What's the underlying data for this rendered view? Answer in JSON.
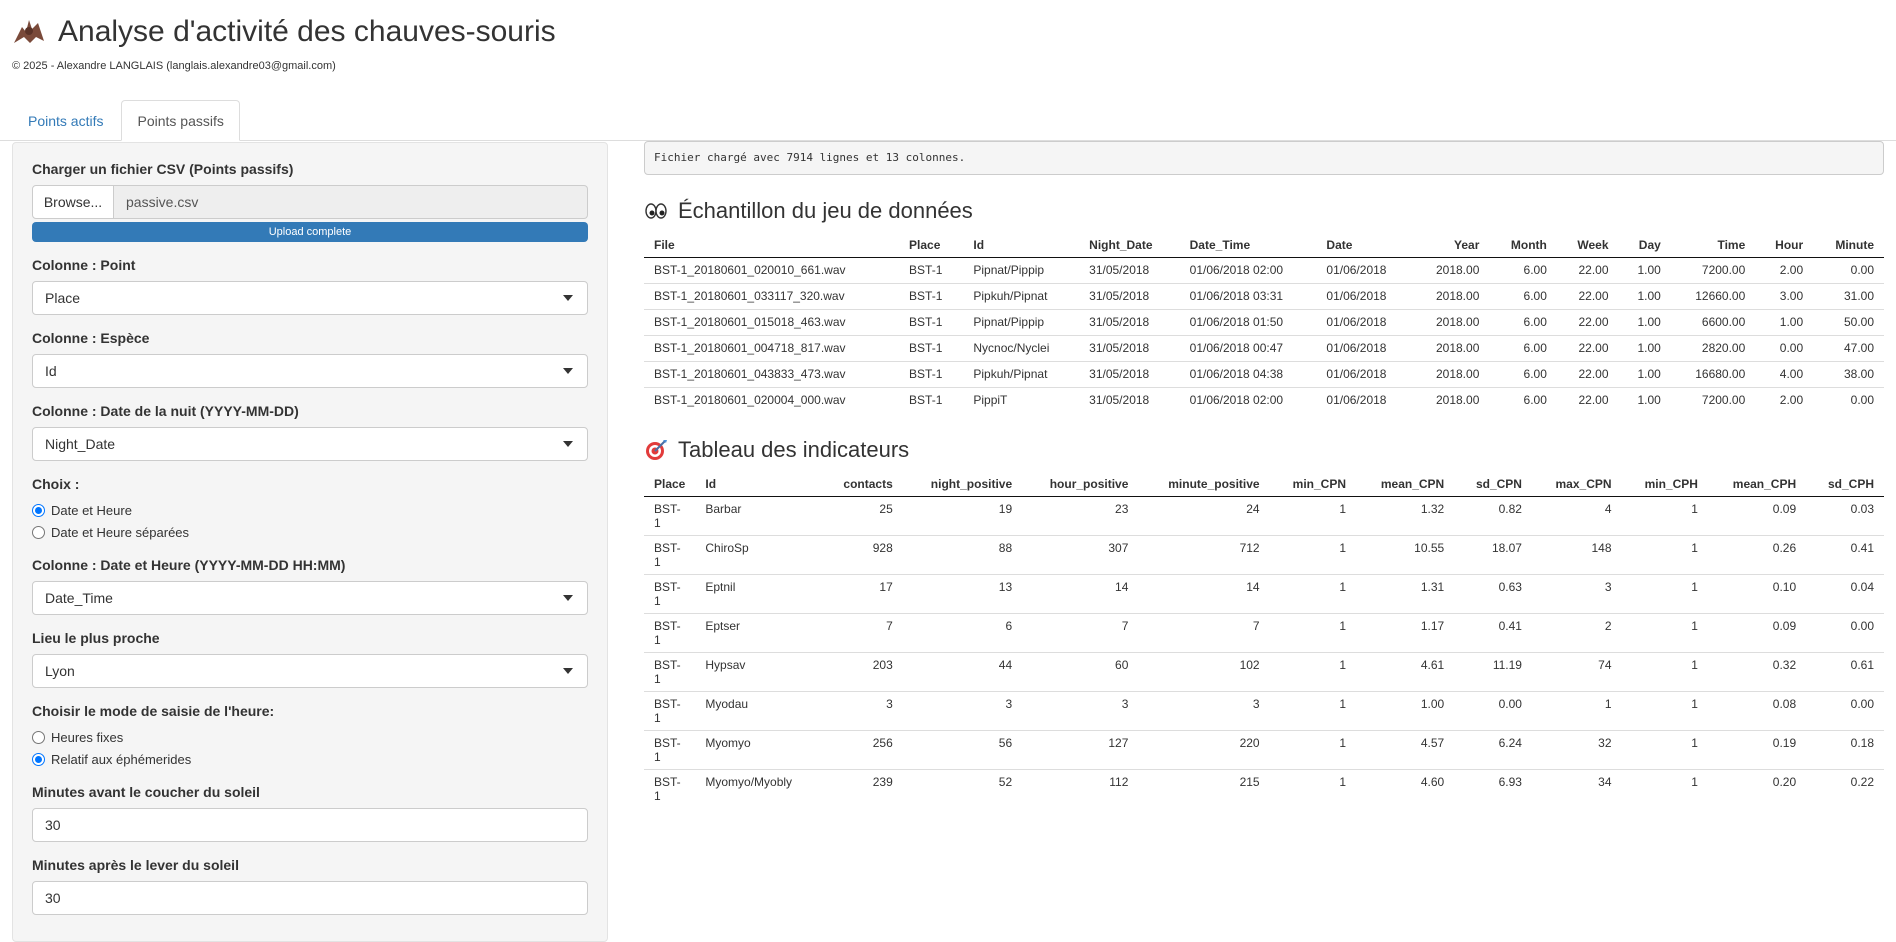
{
  "header": {
    "title": "Analyse d'activité des chauves-souris",
    "copyright": "© 2025 - Alexandre LANGLAIS (langlais.alexandre03@gmail.com)"
  },
  "tabs": [
    {
      "label": "Points actifs",
      "active": false
    },
    {
      "label": "Points passifs",
      "active": true
    }
  ],
  "sidebar": {
    "file_label": "Charger un fichier CSV (Points passifs)",
    "browse_label": "Browse...",
    "file_name": "passive.csv",
    "upload_status": "Upload complete",
    "point_label": "Colonne : Point",
    "point_value": "Place",
    "species_label": "Colonne : Espèce",
    "species_value": "Id",
    "night_label": "Colonne : Date de la nuit (YYYY-MM-DD)",
    "night_value": "Night_Date",
    "choice_label": "Choix :",
    "choice_options": [
      "Date et Heure",
      "Date et Heure séparées"
    ],
    "datetime_label": "Colonne : Date et Heure (YYYY-MM-DD HH:MM)",
    "datetime_value": "Date_Time",
    "place_label": "Lieu le plus proche",
    "place_value": "Lyon",
    "mode_label": "Choisir le mode de saisie de l'heure:",
    "mode_options": [
      "Heures fixes",
      "Relatif aux éphémerides"
    ],
    "before_label": "Minutes avant le coucher du soleil",
    "before_value": "30",
    "after_label": "Minutes après le lever du soleil",
    "after_value": "30"
  },
  "main": {
    "status": "Fichier chargé avec 7914 lignes et 13 colonnes.",
    "sample_title": "Échantillon du jeu de données",
    "sample_headers": [
      "File",
      "Place",
      "Id",
      "Night_Date",
      "Date_Time",
      "Date",
      "Year",
      "Month",
      "Week",
      "Day",
      "Time",
      "Hour",
      "Minute"
    ],
    "sample_rows": [
      [
        "BST-1_20180601_020010_661.wav",
        "BST-1",
        "Pipnat/Pippip",
        "31/05/2018",
        "01/06/2018 02:00",
        "01/06/2018",
        "2018.00",
        "6.00",
        "22.00",
        "1.00",
        "7200.00",
        "2.00",
        "0.00"
      ],
      [
        "BST-1_20180601_033117_320.wav",
        "BST-1",
        "Pipkuh/Pipnat",
        "31/05/2018",
        "01/06/2018 03:31",
        "01/06/2018",
        "2018.00",
        "6.00",
        "22.00",
        "1.00",
        "12660.00",
        "3.00",
        "31.00"
      ],
      [
        "BST-1_20180601_015018_463.wav",
        "BST-1",
        "Pipnat/Pippip",
        "31/05/2018",
        "01/06/2018 01:50",
        "01/06/2018",
        "2018.00",
        "6.00",
        "22.00",
        "1.00",
        "6600.00",
        "1.00",
        "50.00"
      ],
      [
        "BST-1_20180601_004718_817.wav",
        "BST-1",
        "Nycnoc/Nyclei",
        "31/05/2018",
        "01/06/2018 00:47",
        "01/06/2018",
        "2018.00",
        "6.00",
        "22.00",
        "1.00",
        "2820.00",
        "0.00",
        "47.00"
      ],
      [
        "BST-1_20180601_043833_473.wav",
        "BST-1",
        "Pipkuh/Pipnat",
        "31/05/2018",
        "01/06/2018 04:38",
        "01/06/2018",
        "2018.00",
        "6.00",
        "22.00",
        "1.00",
        "16680.00",
        "4.00",
        "38.00"
      ],
      [
        "BST-1_20180601_020004_000.wav",
        "BST-1",
        "PippiT",
        "31/05/2018",
        "01/06/2018 02:00",
        "01/06/2018",
        "2018.00",
        "6.00",
        "22.00",
        "1.00",
        "7200.00",
        "2.00",
        "0.00"
      ]
    ],
    "indicators_title": "Tableau des indicateurs",
    "ind_headers": [
      "Place",
      "Id",
      "contacts",
      "night_positive",
      "hour_positive",
      "minute_positive",
      "min_CPN",
      "mean_CPN",
      "sd_CPN",
      "max_CPN",
      "min_CPH",
      "mean_CPH",
      "sd_CPH"
    ],
    "ind_rows": [
      [
        "BST-1",
        "Barbar",
        "25",
        "19",
        "23",
        "24",
        "1",
        "1.32",
        "0.82",
        "4",
        "1",
        "0.09",
        "0.03"
      ],
      [
        "BST-1",
        "ChiroSp",
        "928",
        "88",
        "307",
        "712",
        "1",
        "10.55",
        "18.07",
        "148",
        "1",
        "0.26",
        "0.41"
      ],
      [
        "BST-1",
        "Eptnil",
        "17",
        "13",
        "14",
        "14",
        "1",
        "1.31",
        "0.63",
        "3",
        "1",
        "0.10",
        "0.04"
      ],
      [
        "BST-1",
        "Eptser",
        "7",
        "6",
        "7",
        "7",
        "1",
        "1.17",
        "0.41",
        "2",
        "1",
        "0.09",
        "0.00"
      ],
      [
        "BST-1",
        "Hypsav",
        "203",
        "44",
        "60",
        "102",
        "1",
        "4.61",
        "11.19",
        "74",
        "1",
        "0.32",
        "0.61"
      ],
      [
        "BST-1",
        "Myodau",
        "3",
        "3",
        "3",
        "3",
        "1",
        "1.00",
        "0.00",
        "1",
        "1",
        "0.08",
        "0.00"
      ],
      [
        "BST-1",
        "Myomyo",
        "256",
        "56",
        "127",
        "220",
        "1",
        "4.57",
        "6.24",
        "32",
        "1",
        "0.19",
        "0.18"
      ],
      [
        "BST-1",
        "Myomyo/Myobly",
        "239",
        "52",
        "112",
        "215",
        "1",
        "4.60",
        "6.93",
        "34",
        "1",
        "0.20",
        "0.22"
      ]
    ]
  }
}
